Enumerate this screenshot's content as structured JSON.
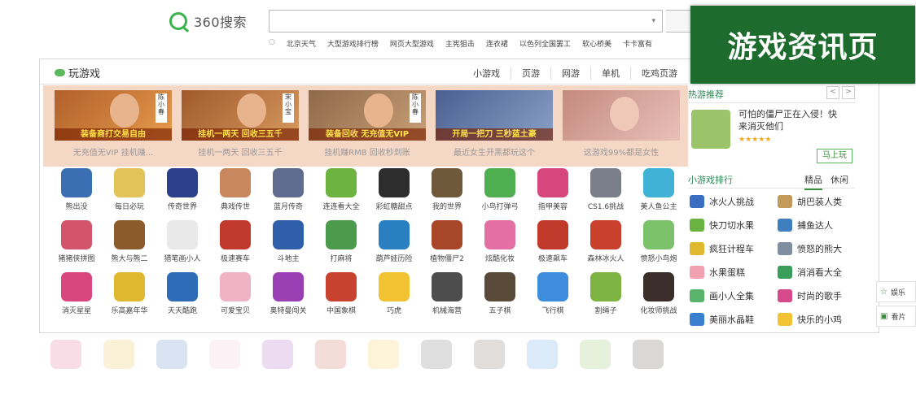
{
  "header": {
    "logo_text": "360搜索",
    "search_value": "",
    "hotwords": [
      "北京天气",
      "大型游戏排行榜",
      "网页大型游戏",
      "主宪狙击",
      "连衣裙",
      "以色列全国罢工",
      "软心桥美",
      "卡卡富有"
    ]
  },
  "page_badge": "游戏资讯页",
  "panel": {
    "title": "玩游戏",
    "tabs": [
      "小游戏",
      "页游",
      "网游",
      "单机",
      "吃鸡页游"
    ]
  },
  "banners": [
    {
      "overlay": "装备商打交易自由",
      "caption": "无充值无VIP 挂机赚...",
      "badge": "陈小春"
    },
    {
      "overlay": "挂机一两天 回收三五千",
      "caption": "挂机一两天 回收三五千",
      "badge": "宋小宝"
    },
    {
      "overlay": "装备回收 无充值无VIP",
      "caption": "挂机赚RMB 回收秒到账",
      "badge": "陈小春"
    },
    {
      "overlay": "开局一把刀 三秒蓝土豪",
      "caption": "最近女生开黑都玩这个",
      "badge": ""
    },
    {
      "overlay": "",
      "caption": "这游戏99%都是女性",
      "badge": ""
    }
  ],
  "games": [
    [
      "熊出没",
      "每日必玩",
      "传奇世界",
      "典戏传世",
      "蓝月传奇",
      "连连看大全",
      "彩虹糖甜点",
      "我的世界",
      "小鸟打弹弓",
      "指甲美容",
      "CS1.6挑战",
      "美人鱼公主"
    ],
    [
      "猪猪侠拼图",
      "熊大与熊二",
      "猎笔画小人",
      "极速赛车",
      "斗地主",
      "打麻将",
      "葫芦娃历险",
      "植物僵尸2",
      "炫酷化妆",
      "极速飙车",
      "森林冰火人",
      "愤怒小鸟炮"
    ],
    [
      "消灭星星",
      "乐高嘉年华",
      "天天酷跑",
      "可爱宝贝",
      "奥特曼闯关",
      "中国象棋",
      "巧虎",
      "机械海营",
      "五子棋",
      "飞行棋",
      "割绳子",
      "化妆师挑战"
    ]
  ],
  "game_colors": [
    [
      "#3b6fb4",
      "#e3c25a",
      "#2c3f8a",
      "#c9875e",
      "#5f6c8f",
      "#6db33f",
      "#2d2d2d",
      "#6e5a3a",
      "#4fae4f",
      "#d7467c",
      "#7a7f8a",
      "#3fb2d6"
    ],
    [
      "#d3556b",
      "#8b5b2b",
      "#e9e9e9",
      "#c0392b",
      "#2e5fa8",
      "#4c9b4c",
      "#2a7fc1",
      "#a8462a",
      "#e46fa3",
      "#c0392b",
      "#c9402d",
      "#7cc26b"
    ],
    [
      "#d9467f",
      "#e0b82f",
      "#2f6cb7",
      "#f0b3c6",
      "#9b3fb5",
      "#c8432f",
      "#f1c232",
      "#4d4d4d",
      "#5a4a3a",
      "#3e8ddd",
      "#7cb342",
      "#3a2f2a"
    ]
  ],
  "hot": {
    "title": "热游推荐",
    "desc": "可怕的僵尸正在入侵！快来消灭他们",
    "stars": "★★★★★",
    "play_label": "马上玩"
  },
  "rank": {
    "title": "小游戏排行",
    "tabs": [
      "精品",
      "休闲"
    ],
    "items": [
      [
        "冰火人挑战",
        "胡巴装人类"
      ],
      [
        "快刀切水果",
        "捕鱼达人"
      ],
      [
        "疯狂计程车",
        "愤怒的熊大"
      ],
      [
        "水果蛋糕",
        "消消看大全"
      ],
      [
        "画小人全集",
        "时尚的歌手"
      ],
      [
        "美丽水晶鞋",
        "快乐的小鸡"
      ]
    ],
    "colors": [
      [
        "#3a6fc4",
        "#c49a5a"
      ],
      [
        "#6bb33f",
        "#3f7fbf"
      ],
      [
        "#e0b82f",
        "#7f8fa0"
      ],
      [
        "#f0a0b0",
        "#3a9d5a"
      ],
      [
        "#5ab36b",
        "#d44a8a"
      ],
      [
        "#3a7fd0",
        "#f1c232"
      ]
    ]
  },
  "side": [
    "娱乐",
    "看片"
  ]
}
